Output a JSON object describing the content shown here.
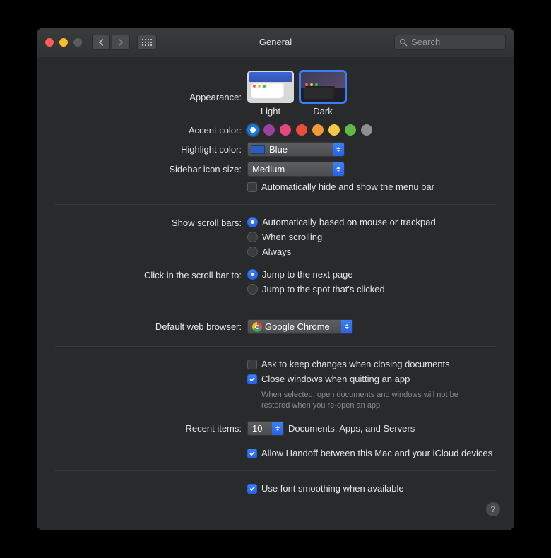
{
  "window": {
    "title": "General"
  },
  "search": {
    "placeholder": "Search"
  },
  "appearance": {
    "label": "Appearance:",
    "light": "Light",
    "dark": "Dark",
    "selected": "dark"
  },
  "accent": {
    "label": "Accent color:",
    "colors": [
      "#0a7bff",
      "#9b3fa1",
      "#e8467f",
      "#eb4d3d",
      "#f19a37",
      "#f7c845",
      "#62ba46",
      "#8e8e93"
    ],
    "selected": 0
  },
  "highlight": {
    "label": "Highlight color:",
    "value": "Blue"
  },
  "sidebar_size": {
    "label": "Sidebar icon size:",
    "value": "Medium"
  },
  "autohide_menubar": {
    "label": "Automatically hide and show the menu bar",
    "checked": false
  },
  "scrollbars": {
    "label": "Show scroll bars:",
    "options": [
      "Automatically based on mouse or trackpad",
      "When scrolling",
      "Always"
    ],
    "selected": 0
  },
  "click_scroll": {
    "label": "Click in the scroll bar to:",
    "options": [
      "Jump to the next page",
      "Jump to the spot that's clicked"
    ],
    "selected": 0
  },
  "browser": {
    "label": "Default web browser:",
    "value": "Google Chrome"
  },
  "ask_keep": {
    "label": "Ask to keep changes when closing documents",
    "checked": false
  },
  "close_windows": {
    "label": "Close windows when quitting an app",
    "checked": true,
    "hint": "When selected, open documents and windows will not be restored when you re-open an app."
  },
  "recent": {
    "label": "Recent items:",
    "value": "10",
    "suffix": "Documents, Apps, and Servers"
  },
  "handoff": {
    "label": "Allow Handoff between this Mac and your iCloud devices",
    "checked": true
  },
  "font_smoothing": {
    "label": "Use font smoothing when available",
    "checked": true
  },
  "help": "?"
}
